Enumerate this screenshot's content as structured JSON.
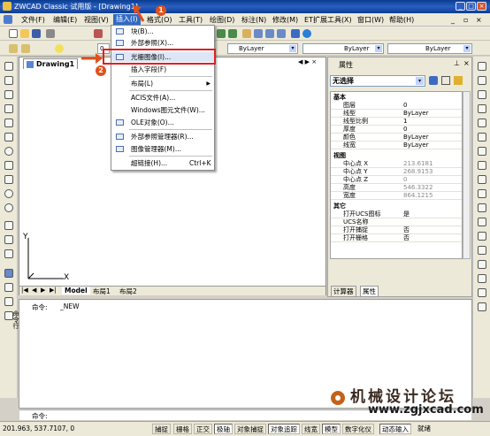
{
  "app": {
    "title": "ZWCAD Classic 试用版 - [Drawing1]"
  },
  "menubar": [
    "文件(F)",
    "编辑(E)",
    "视图(V)",
    "插入(I)",
    "格式(O)",
    "工具(T)",
    "绘图(D)",
    "标注(N)",
    "修改(M)",
    "ET扩展工具(X)",
    "窗口(W)",
    "帮助(H)"
  ],
  "toolbar": {
    "layer_value": "0",
    "color_value": "ByLayer",
    "linetype_value": "ByLayer",
    "lineweight_value": "ByLayer"
  },
  "insert_menu": {
    "items": [
      {
        "label": "块(B)..."
      },
      {
        "label": "外部参照(X)..."
      },
      {
        "label": "光栅图像(I)..."
      },
      {
        "label": "插入字段(F)"
      },
      {
        "label": "布局(L)"
      },
      {
        "label": "ACIS文件(A)..."
      },
      {
        "label": "Windows图元文件(W)..."
      },
      {
        "label": "OLE对象(O)..."
      },
      {
        "label": "外部参照管理器(R)..."
      },
      {
        "label": "图像管理器(M)..."
      },
      {
        "label": "超链接(H)...",
        "shortcut": "Ctrl+K"
      }
    ]
  },
  "callouts": [
    "1",
    "2"
  ],
  "drawing": {
    "tab": "Drawing1",
    "axis_y": "Y",
    "axis_x": "X",
    "layout_tabs": [
      "Model",
      "布局1",
      "布局2"
    ]
  },
  "properties": {
    "title": "属性",
    "selection": "无选择",
    "sections": [
      {
        "name": "基本",
        "rows": [
          [
            "图层",
            "0"
          ],
          [
            "线型",
            "ByLayer"
          ],
          [
            "线型比例",
            "1"
          ],
          [
            "厚度",
            "0"
          ],
          [
            "颜色",
            "ByLayer"
          ],
          [
            "线宽",
            "ByLayer"
          ]
        ]
      },
      {
        "name": "视图",
        "rows": [
          [
            "中心点 X",
            "213.6181"
          ],
          [
            "中心点 Y",
            "268.9153"
          ],
          [
            "中心点 Z",
            "0"
          ],
          [
            "高度",
            "546.3322"
          ],
          [
            "宽度",
            "864.1215"
          ]
        ]
      },
      {
        "name": "其它",
        "rows": [
          [
            "打开UCS图标",
            "是"
          ],
          [
            "UCS名称",
            ""
          ],
          [
            "打开捕捉",
            "否"
          ],
          [
            "打开栅格",
            "否"
          ]
        ]
      }
    ],
    "tabs": [
      "计算器",
      "属性"
    ]
  },
  "command": {
    "history_label": "命令:",
    "history_value": "_NEW",
    "prompt": "命令:",
    "side_label": "命令行"
  },
  "watermark": {
    "text": "机械设计论坛",
    "url": "www.zgjxcad.com"
  },
  "status": {
    "coords": "201.963, 537.7107, 0",
    "buttons": [
      "捕捉",
      "栅格",
      "正交",
      "极轴",
      "对象捕捉",
      "对象追踪",
      "线宽",
      "模型",
      "数字化仪",
      "动态输入",
      "就绪"
    ]
  }
}
